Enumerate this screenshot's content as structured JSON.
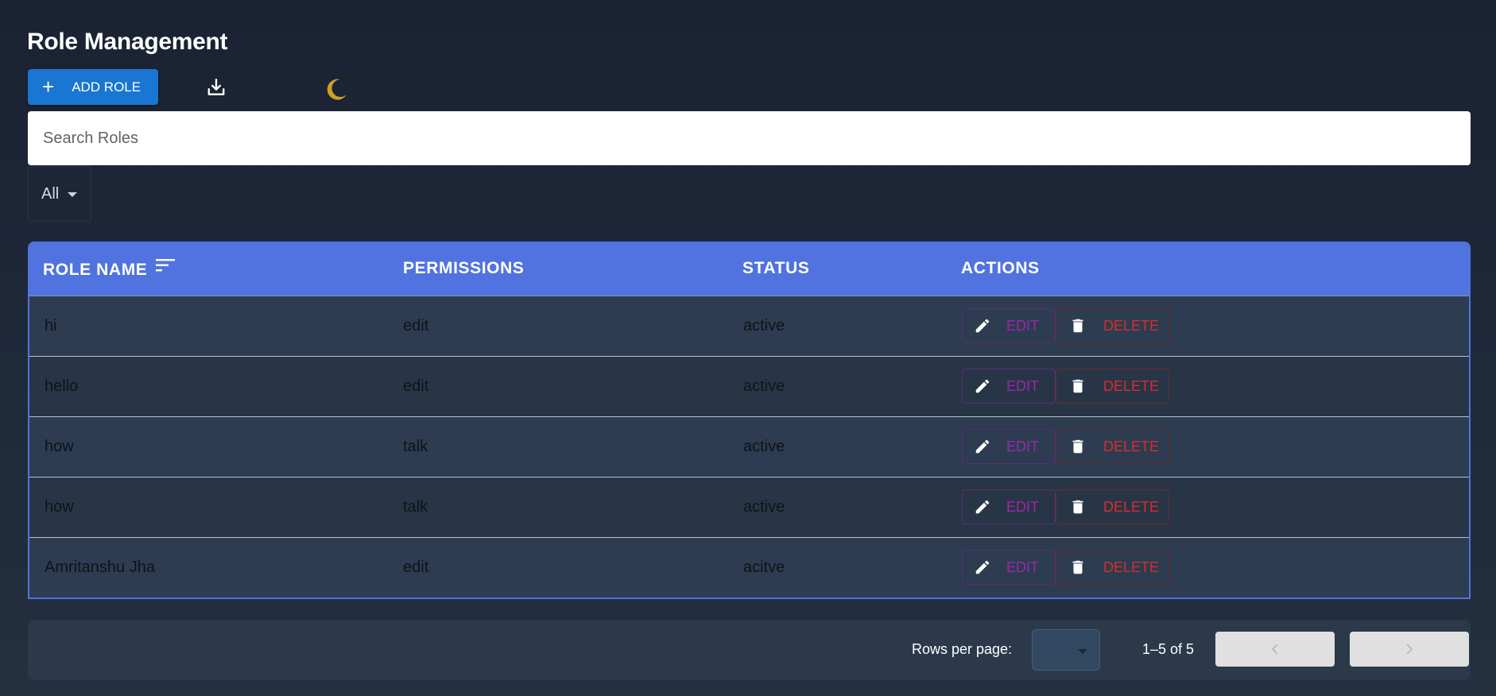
{
  "header": {
    "title": "Role Management"
  },
  "toolbar": {
    "add_role_label": "ADD ROLE",
    "download_icon": "download-icon",
    "theme_icon": "moon-icon",
    "theme_icon_color": "#c9a227"
  },
  "search": {
    "placeholder": "Search Roles",
    "value": ""
  },
  "filter": {
    "selected": "All"
  },
  "table": {
    "header_color": "#5173e0",
    "columns": {
      "role_name": "ROLE NAME",
      "permissions": "PERMISSIONS",
      "status": "STATUS",
      "actions": "ACTIONS"
    },
    "rows": [
      {
        "role_name": "hi",
        "permissions": "edit",
        "status": "active"
      },
      {
        "role_name": "hello",
        "permissions": "edit",
        "status": "active"
      },
      {
        "role_name": "how",
        "permissions": "talk",
        "status": "active"
      },
      {
        "role_name": "how",
        "permissions": "talk",
        "status": "active"
      },
      {
        "role_name": "Amritanshu Jha",
        "permissions": "edit",
        "status": "acitve"
      }
    ],
    "edit_label": "EDIT",
    "delete_label": "DELETE",
    "edit_color": "#9c27b0",
    "delete_color": "#d32f2f"
  },
  "pagination": {
    "rows_per_page_label": "Rows per page:",
    "rows_per_page_value": "",
    "range": "1–5 of 5",
    "prev_icon": "chevron-left-icon",
    "next_icon": "chevron-right-icon"
  }
}
